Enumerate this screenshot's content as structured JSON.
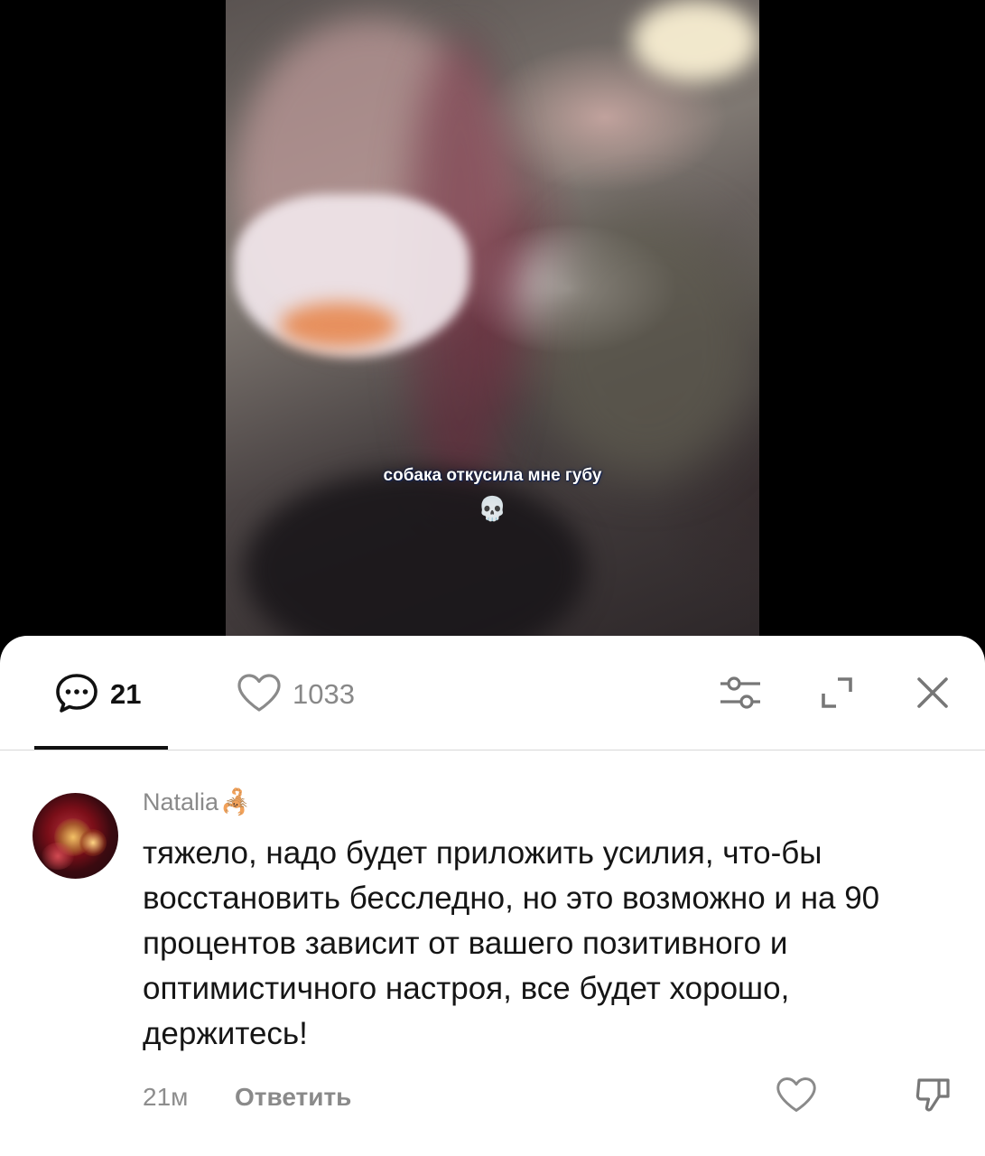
{
  "video": {
    "caption": "собака откусила мне губу",
    "caption_emoji": "💀"
  },
  "tabs": {
    "comments_count": "21",
    "likes_count": "1033"
  },
  "icons": {
    "comments": "speech-bubble-dots-icon",
    "likes": "heart-outline-icon",
    "filter": "sliders-icon",
    "expand": "expand-corners-icon",
    "close": "close-x-icon",
    "comment_like": "heart-outline-icon",
    "comment_dislike": "thumbs-down-icon"
  },
  "comment": {
    "author": "Natalia",
    "author_emoji": "🦂",
    "text": "тяжело, надо будет приложить усилия, что-бы восстановить бесследно, но это возможно и на 90 процентов зависит от вашего позитивного и оптимистичного настроя, все будет хорошо, держитесь!",
    "time": "21м",
    "reply_label": "Ответить"
  },
  "colors": {
    "sheet_background": "#ffffff",
    "primary_text": "#151515",
    "secondary_text": "#8a8a8a",
    "divider": "#d8d8d8",
    "video_background": "#000000"
  }
}
